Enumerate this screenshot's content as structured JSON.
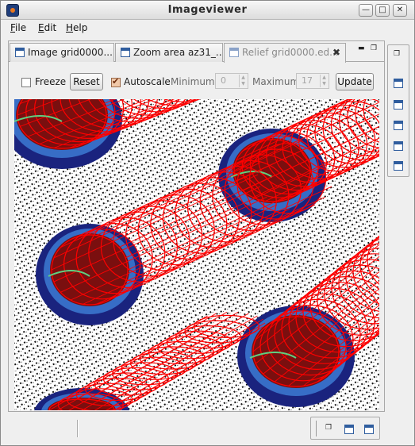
{
  "window": {
    "title": "Imageviewer"
  },
  "menu": [
    {
      "mnemonic": "F",
      "rest": "ile"
    },
    {
      "mnemonic": "E",
      "rest": "dit"
    },
    {
      "mnemonic": "H",
      "rest": "elp"
    }
  ],
  "tabs": [
    {
      "label": "Image grid0000....",
      "active": false
    },
    {
      "label": "Zoom area az31_...",
      "active": false
    },
    {
      "label": "Relief grid0000.ed...",
      "active": true
    }
  ],
  "toolbar": {
    "freeze_label": "Freeze",
    "freeze_checked": false,
    "reset_label": "Reset",
    "autoscale_label": "Autoscale",
    "autoscale_checked": true,
    "minimum_label": "Minimum",
    "minimum_value": "0",
    "maximum_label": "Maximum",
    "maximum_value": "17",
    "update_label": "Update"
  },
  "icons": {
    "tab_close": "close-icon",
    "undock": "float-icon",
    "maximize": "maximize-icon",
    "dock_view": "window-icon"
  },
  "colors": {
    "relief_wire": "#ff0000",
    "relief_base": "#1a237e",
    "relief_mid": "#3f7fd8",
    "relief_low": "#60d080"
  }
}
